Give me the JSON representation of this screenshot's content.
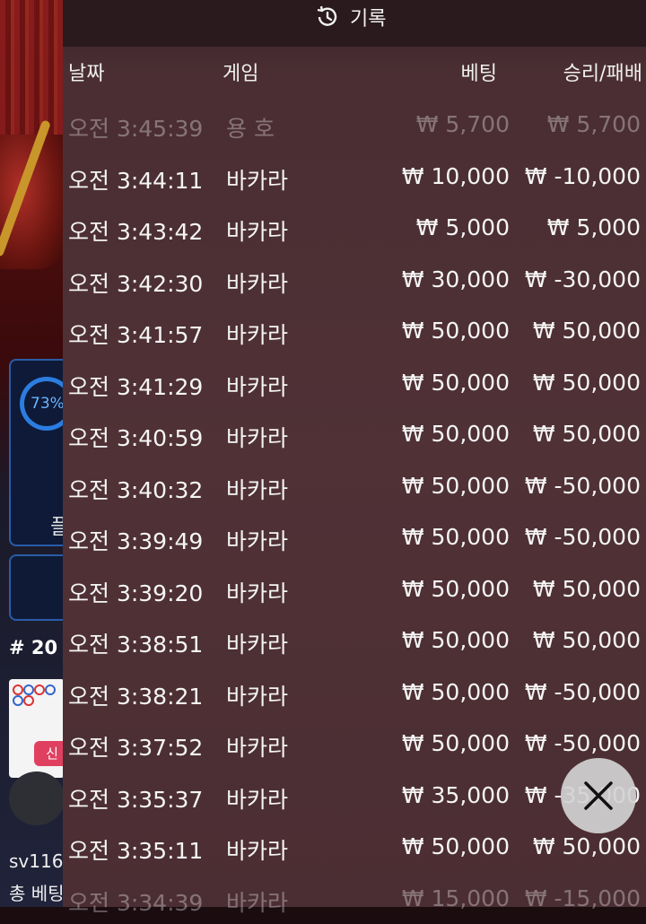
{
  "panel": {
    "title": "기록",
    "icon": "history-icon"
  },
  "columns": {
    "date": "날짜",
    "game": "게임",
    "bet": "베팅",
    "result": "승리/패배"
  },
  "rows": [
    {
      "time": "오전 3:45:39",
      "game": "용 호",
      "bet": "₩ 5,700",
      "result": "₩ 5,700"
    },
    {
      "time": "오전 3:44:11",
      "game": "바카라",
      "bet": "₩ 10,000",
      "result": "₩ -10,000"
    },
    {
      "time": "오전 3:43:42",
      "game": "바카라",
      "bet": "₩ 5,000",
      "result": "₩ 5,000"
    },
    {
      "time": "오전 3:42:30",
      "game": "바카라",
      "bet": "₩ 30,000",
      "result": "₩ -30,000"
    },
    {
      "time": "오전 3:41:57",
      "game": "바카라",
      "bet": "₩ 50,000",
      "result": "₩ 50,000"
    },
    {
      "time": "오전 3:41:29",
      "game": "바카라",
      "bet": "₩ 50,000",
      "result": "₩ 50,000"
    },
    {
      "time": "오전 3:40:59",
      "game": "바카라",
      "bet": "₩ 50,000",
      "result": "₩ 50,000"
    },
    {
      "time": "오전 3:40:32",
      "game": "바카라",
      "bet": "₩ 50,000",
      "result": "₩ -50,000"
    },
    {
      "time": "오전 3:39:49",
      "game": "바카라",
      "bet": "₩ 50,000",
      "result": "₩ -50,000"
    },
    {
      "time": "오전 3:39:20",
      "game": "바카라",
      "bet": "₩ 50,000",
      "result": "₩ 50,000"
    },
    {
      "time": "오전 3:38:51",
      "game": "바카라",
      "bet": "₩ 50,000",
      "result": "₩ 50,000"
    },
    {
      "time": "오전 3:38:21",
      "game": "바카라",
      "bet": "₩ 50,000",
      "result": "₩ -50,000"
    },
    {
      "time": "오전 3:37:52",
      "game": "바카라",
      "bet": "₩ 50,000",
      "result": "₩ -50,000"
    },
    {
      "time": "오전 3:35:37",
      "game": "바카라",
      "bet": "₩ 35,000",
      "result": "₩ -35,000"
    },
    {
      "time": "오전 3:35:11",
      "game": "바카라",
      "bet": "₩ 50,000",
      "result": "₩ 50,000"
    },
    {
      "time": "오전 3:34:39",
      "game": "바카라",
      "bet": "₩ 15,000",
      "result": "₩ -15,000"
    }
  ],
  "background": {
    "percent": "73%",
    "player_label": "플",
    "round": "# 20",
    "new_badge": "신",
    "username": "sv116",
    "total_bet": "총 베팅"
  },
  "close_icon": "close-icon"
}
